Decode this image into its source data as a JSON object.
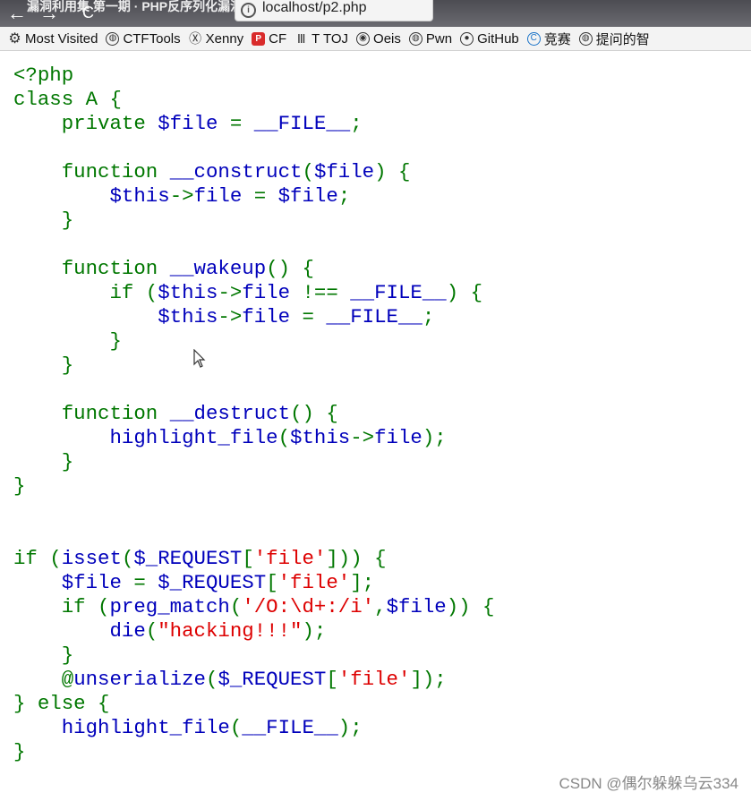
{
  "window": {
    "tab_title": "漏洞利用集 第一期 · PHP反序列化漏洞绕过",
    "url": "localhost/p2.php",
    "back_glyph": "←",
    "forward_glyph": "→",
    "reload_glyph": "C"
  },
  "bookmarks": [
    {
      "label": "Most Visited",
      "icon": "gear-icon"
    },
    {
      "label": "CTFTools",
      "icon": "globe-icon"
    },
    {
      "label": "Xenny",
      "icon": "xenny-icon"
    },
    {
      "label": "CF",
      "icon": "p-icon"
    },
    {
      "label": "T TOJ",
      "icon": "tt-icon"
    },
    {
      "label": "Oeis",
      "icon": "oeis-icon"
    },
    {
      "label": "Pwn",
      "icon": "globe-icon"
    },
    {
      "label": "GitHub",
      "icon": "github-icon"
    },
    {
      "label": "竞赛",
      "icon": "contest-icon"
    },
    {
      "label": "提问的智",
      "icon": "globe-icon"
    }
  ],
  "code": [
    [
      [
        "k",
        "<?php"
      ]
    ],
    [
      [
        "k",
        "class A {"
      ]
    ],
    [
      [
        "k",
        "    private "
      ],
      [
        "v",
        "$file"
      ],
      [
        "k",
        " = "
      ],
      [
        "v",
        "__FILE__"
      ],
      [
        "k",
        ";"
      ]
    ],
    [],
    [
      [
        "k",
        "    function "
      ],
      [
        "v",
        "__construct"
      ],
      [
        "k",
        "("
      ],
      [
        "v",
        "$file"
      ],
      [
        "k",
        ") {"
      ]
    ],
    [
      [
        "v",
        "        $this"
      ],
      [
        "k",
        "->"
      ],
      [
        "v",
        "file"
      ],
      [
        "k",
        " = "
      ],
      [
        "v",
        "$file"
      ],
      [
        "k",
        ";"
      ]
    ],
    [
      [
        "k",
        "    }"
      ]
    ],
    [],
    [
      [
        "k",
        "    function "
      ],
      [
        "v",
        "__wakeup"
      ],
      [
        "k",
        "() {"
      ]
    ],
    [
      [
        "k",
        "        if ("
      ],
      [
        "v",
        "$this"
      ],
      [
        "k",
        "->"
      ],
      [
        "v",
        "file"
      ],
      [
        "k",
        " !== "
      ],
      [
        "v",
        "__FILE__"
      ],
      [
        "k",
        ") {"
      ]
    ],
    [
      [
        "v",
        "            $this"
      ],
      [
        "k",
        "->"
      ],
      [
        "v",
        "file"
      ],
      [
        "k",
        " = "
      ],
      [
        "v",
        "__FILE__"
      ],
      [
        "k",
        ";"
      ]
    ],
    [
      [
        "k",
        "        }"
      ]
    ],
    [
      [
        "k",
        "    }"
      ]
    ],
    [],
    [
      [
        "k",
        "    function "
      ],
      [
        "v",
        "__destruct"
      ],
      [
        "k",
        "() {"
      ]
    ],
    [
      [
        "v",
        "        highlight_file"
      ],
      [
        "k",
        "("
      ],
      [
        "v",
        "$this"
      ],
      [
        "k",
        "->"
      ],
      [
        "v",
        "file"
      ],
      [
        "k",
        ");"
      ]
    ],
    [
      [
        "k",
        "    }"
      ]
    ],
    [
      [
        "k",
        "}"
      ]
    ],
    [],
    [],
    [
      [
        "k",
        "if ("
      ],
      [
        "v",
        "isset"
      ],
      [
        "k",
        "("
      ],
      [
        "v",
        "$_REQUEST"
      ],
      [
        "k",
        "["
      ],
      [
        "s",
        "'file'"
      ],
      [
        "k",
        "])) {"
      ]
    ],
    [
      [
        "v",
        "    $file"
      ],
      [
        "k",
        " = "
      ],
      [
        "v",
        "$_REQUEST"
      ],
      [
        "k",
        "["
      ],
      [
        "s",
        "'file'"
      ],
      [
        "k",
        "];"
      ]
    ],
    [
      [
        "k",
        "    if ("
      ],
      [
        "v",
        "preg_match"
      ],
      [
        "k",
        "("
      ],
      [
        "s",
        "'/O:\\d+:/i'"
      ],
      [
        "k",
        ","
      ],
      [
        "v",
        "$file"
      ],
      [
        "k",
        ")) {"
      ]
    ],
    [
      [
        "v",
        "        die"
      ],
      [
        "k",
        "("
      ],
      [
        "s",
        "\"hacking!!!\""
      ],
      [
        "k",
        ");"
      ]
    ],
    [
      [
        "k",
        "    }"
      ]
    ],
    [
      [
        "k",
        "    @"
      ],
      [
        "v",
        "unserialize"
      ],
      [
        "k",
        "("
      ],
      [
        "v",
        "$_REQUEST"
      ],
      [
        "k",
        "["
      ],
      [
        "s",
        "'file'"
      ],
      [
        "k",
        "]);"
      ]
    ],
    [
      [
        "k",
        "} else {"
      ]
    ],
    [
      [
        "v",
        "    highlight_file"
      ],
      [
        "k",
        "("
      ],
      [
        "v",
        "__FILE__"
      ],
      [
        "k",
        ");"
      ]
    ],
    [
      [
        "k",
        "}"
      ]
    ]
  ],
  "watermark": "CSDN @偶尔躲躲乌云334"
}
